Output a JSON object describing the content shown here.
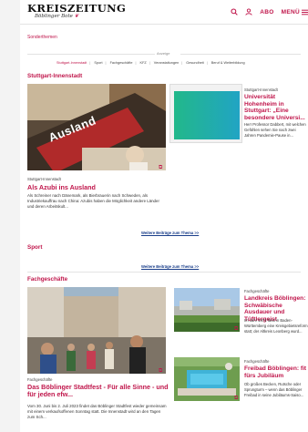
{
  "header": {
    "logo_main": "KREISZEITUNG",
    "logo_sub": "Böblinger Bote",
    "abo_label": "ABO",
    "menu_label": "MENÜ"
  },
  "sonderthemen_label": "Sonderthemen",
  "anzeige_label": "Anzeige",
  "category_nav": [
    "Stuttgart-Innenstadt",
    "Sport",
    "Fachgeschäfte",
    "KFZ",
    "Veranstaltungen",
    "Gesundheit",
    "Beruf & Weiterbildung"
  ],
  "sections": {
    "stuttgart": {
      "heading": "Stuttgart-Innenstadt",
      "lead": {
        "image_text": "Ausland",
        "tag": "Stuttgart-Innenstadt",
        "title": "Als Azubi ins Ausland",
        "teaser": "Als Schreiner nach Dänemark, als Bierbrauerin nach Schweden, als Industriekauffrau nach China: Azubis haben die Möglichkeit andere Länder und deren Arbeitskult..."
      },
      "side": {
        "tag": "Stuttgart-Innenstadt",
        "title": "Universität Hohenheim in Stuttgart: „Eine besondere Universi...",
        "teaser": "Herr Professor Dabbert, mit welchen Gefühlen sehen Sie nach zwei Jahren Pandemie-Pause in..."
      },
      "more_label": "Weitere Beiträge zum Thema >>"
    },
    "sport": {
      "heading": "Sport",
      "more_label": "Weitere Beiträge zum Thema >>"
    },
    "fach": {
      "heading": "Fachgeschäfte",
      "lead": {
        "tag": "Fachgeschäfte",
        "title": "Das Böblinger Stadtfest - Für alle Sinne - und für jeden efw...",
        "teaser": "Vom 30. Juni bis 2. Juli 2023 findet das Böblinger Stadtfest wieder gemeinsam mit einem verkaufsoffenen Sonntag statt. Die Innenstadt wird an den Tagen zum Sch..."
      },
      "item1": {
        "tag": "Fachgeschäfte",
        "title": "Landkreis Böblingen: Schwäbische Ausdauer und Tüftlergeist",
        "teaser": "Im Jahr 1973 fand in Baden-Württemberg eine Kreisgebietsreform statt; der Altkreis Leonberg wurd..."
      },
      "item2": {
        "tag": "Fachgeschäfte",
        "title": "Freibad Böblingen: fit fürs Jubiläum",
        "teaser": "Ob großes Becken, Rutsche oder Sprungturm – wenn das Böblinger Freibad in seine Jubiläums-Saiso..."
      }
    }
  },
  "colors": {
    "accent": "#c0164b",
    "link": "#1a3e8a"
  }
}
